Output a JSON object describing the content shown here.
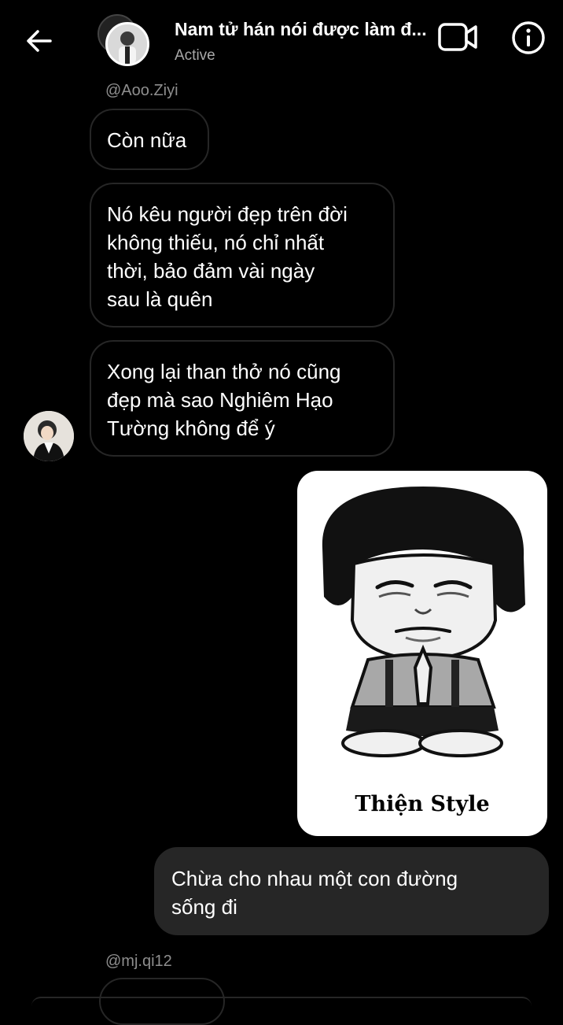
{
  "header": {
    "title": "Nam tử hán nói được làm đ...",
    "status": "Active",
    "icons": {
      "back": "arrow-left-icon",
      "video": "video-camera-icon",
      "info": "info-circle-icon"
    }
  },
  "messages": [
    {
      "username": "@Aoo.Ziyi"
    },
    {
      "text": "Còn nữa"
    },
    {
      "lines": [
        "Nó kêu người đẹp trên đời",
        "không thiếu, nó chỉ nhất",
        "thời, bảo đảm vài ngày",
        "sau là quên"
      ]
    },
    {
      "lines": [
        "Xong lại than thở nó cũng",
        "đẹp mà sao Nghiêm Hạo",
        "Tường không để ý"
      ]
    },
    {
      "sticker_caption": "Thiện Style"
    },
    {
      "lines": [
        "Chừa cho nhau một con đường",
        "sống đi"
      ]
    },
    {
      "username": "@mj.qi12"
    }
  ]
}
